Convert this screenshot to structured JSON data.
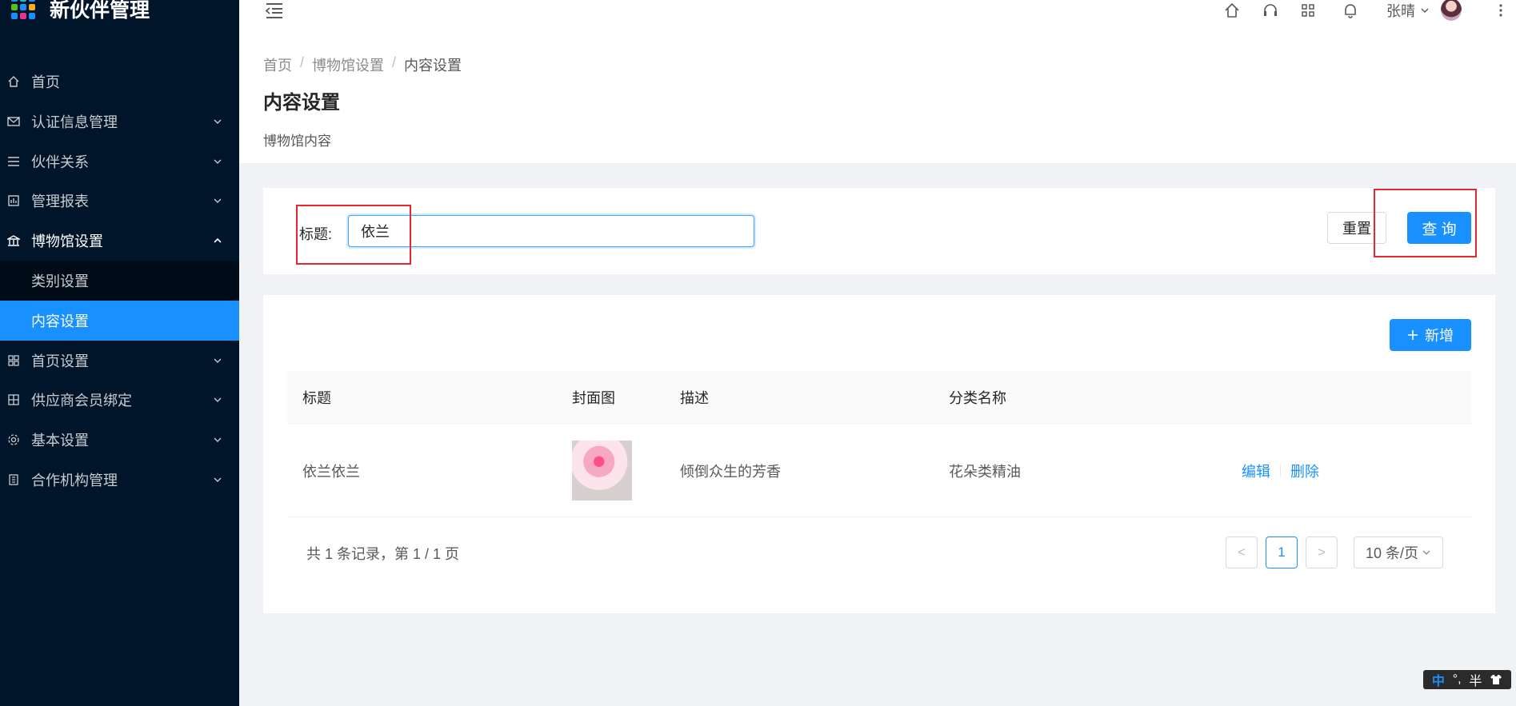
{
  "app": {
    "title": "新伙伴管理"
  },
  "sidebar": {
    "items": [
      {
        "label": "首页",
        "icon": "home-icon"
      },
      {
        "label": "认证信息管理",
        "icon": "mail-icon"
      },
      {
        "label": "伙伴关系",
        "icon": "list-icon"
      },
      {
        "label": "管理报表",
        "icon": "report-icon"
      },
      {
        "label": "博物馆设置",
        "icon": "bank-icon",
        "open": true
      },
      {
        "label": "首页设置",
        "icon": "layout-icon"
      },
      {
        "label": "供应商会员绑定",
        "icon": "grid-icon"
      },
      {
        "label": "基本设置",
        "icon": "gear-icon"
      },
      {
        "label": "合作机构管理",
        "icon": "building-icon"
      }
    ],
    "sub_items": [
      {
        "label": "类别设置"
      },
      {
        "label": "内容设置",
        "active": true
      }
    ]
  },
  "header": {
    "user_name": "张晴",
    "icons": [
      "home-icon",
      "headset-icon",
      "apps-icon",
      "bell-icon",
      "more-icon"
    ]
  },
  "breadcrumb": {
    "items": [
      "首页",
      "博物馆设置",
      "内容设置"
    ],
    "separator": "/"
  },
  "page": {
    "title": "内容设置",
    "subtitle": "博物馆内容"
  },
  "search": {
    "label": "标题:",
    "value": "依兰",
    "reset_label": "重置",
    "query_label": "查 询"
  },
  "table": {
    "add_label": "新增",
    "columns": [
      "标题",
      "封面图",
      "描述",
      "分类名称"
    ],
    "rows": [
      {
        "title": "依兰依兰",
        "description": "倾倒众生的芳香",
        "category": "花朵类精油",
        "actions": [
          "编辑",
          "删除"
        ]
      }
    ]
  },
  "pagination": {
    "summary": "共 1 条记录，第 1 / 1 页",
    "current_page": "1",
    "prev": "<",
    "next": ">",
    "page_size": "10 条/页"
  },
  "ime": {
    "mode": "中",
    "punct": "°,",
    "width": "半"
  },
  "colors": {
    "primary": "#1890ff",
    "sidebar_bg": "#001529",
    "highlight": "#e8262f"
  }
}
